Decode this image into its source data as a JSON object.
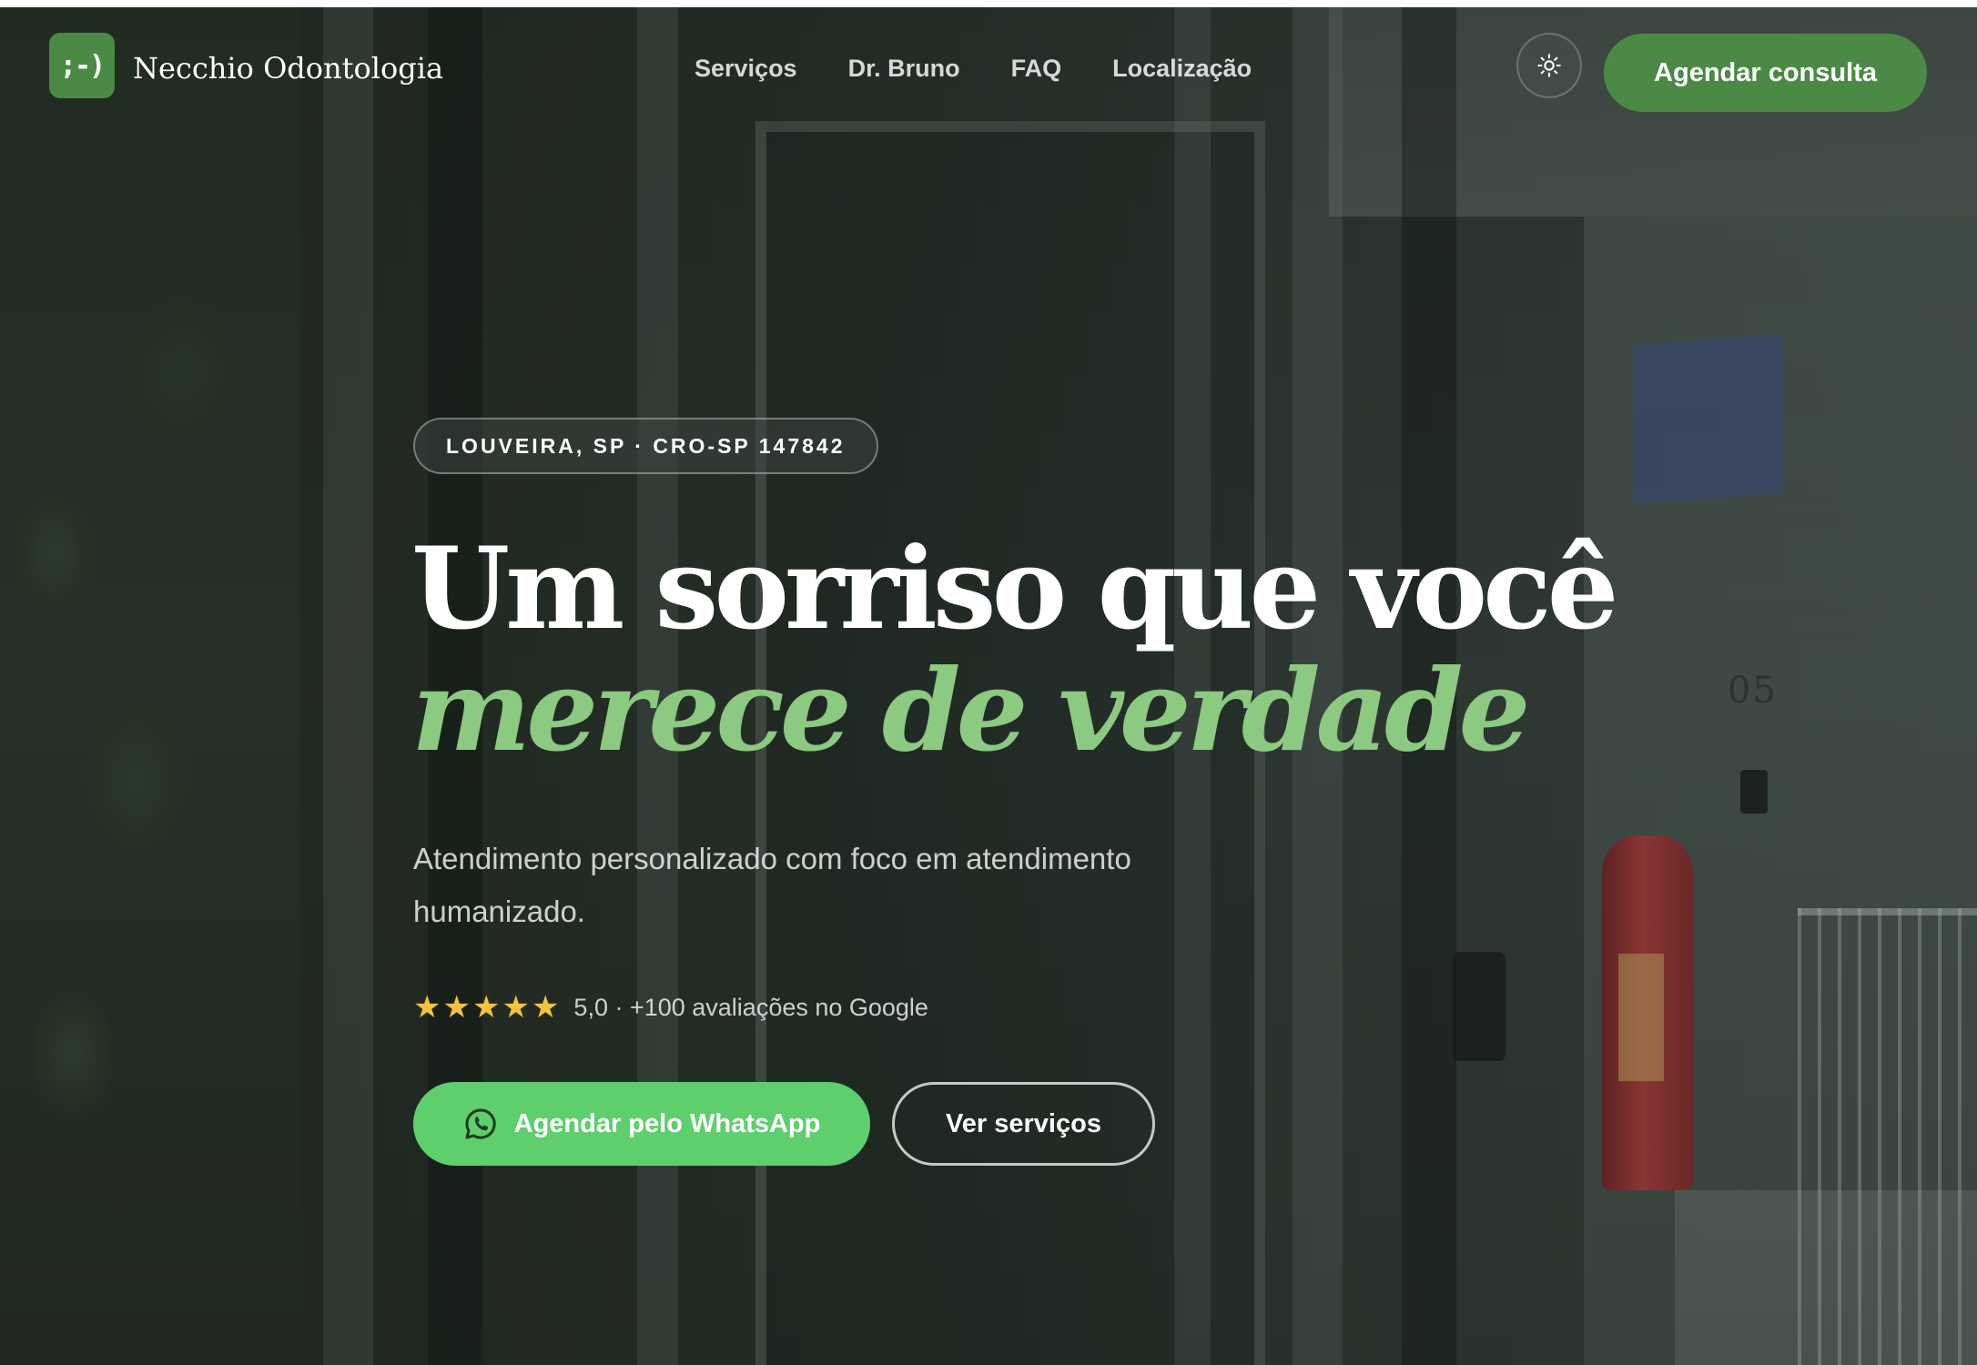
{
  "nav": {
    "logo_text": ";-)",
    "brand": "Necchio Odontologia",
    "links": [
      "Serviços",
      "Dr. Bruno",
      "FAQ",
      "Localização"
    ],
    "theme_toggle_icon": "sun-icon",
    "cta_label": "Agendar consulta"
  },
  "hero": {
    "badge": "LOUVEIRA, SP · CRO-SP 147842",
    "headline_line1": "Um sorriso que você",
    "headline_line2": "merece de verdade",
    "subtitle": "Atendimento personalizado com foco em atendimento humanizado.",
    "rating": {
      "stars": 5,
      "text": "5,0 · +100 avaliações no Google"
    },
    "primary_button": {
      "label": "Agendar pelo WhatsApp",
      "icon": "whatsapp-icon"
    },
    "secondary_button": {
      "label": "Ver serviços"
    },
    "background_sign_number": "05"
  },
  "colors": {
    "brand_green": "#4b8a45",
    "accent_green": "#8cc981",
    "whatsapp_green": "#5fcf6e",
    "star_yellow": "#f3c33c"
  }
}
